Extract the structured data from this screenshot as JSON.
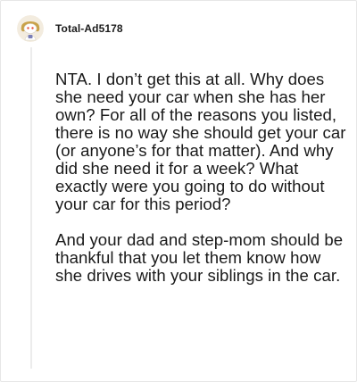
{
  "comment": {
    "username": "Total-Ad5178",
    "avatar": {
      "icon": "reddit-snoo-avatar-icon",
      "accent": "#c9a24a"
    },
    "paragraphs": [
      "NTA. I don’t get this at all. Why does she need your car when she has her own? For all of the reasons you listed, there is no way she should get your car (or anyone’s for that matter). And why did she need it for a week? What exactly were you going to do without your car for this period?",
      "And your dad and step-mom should be thankful that you let them know how she drives with your siblings in the car."
    ]
  }
}
